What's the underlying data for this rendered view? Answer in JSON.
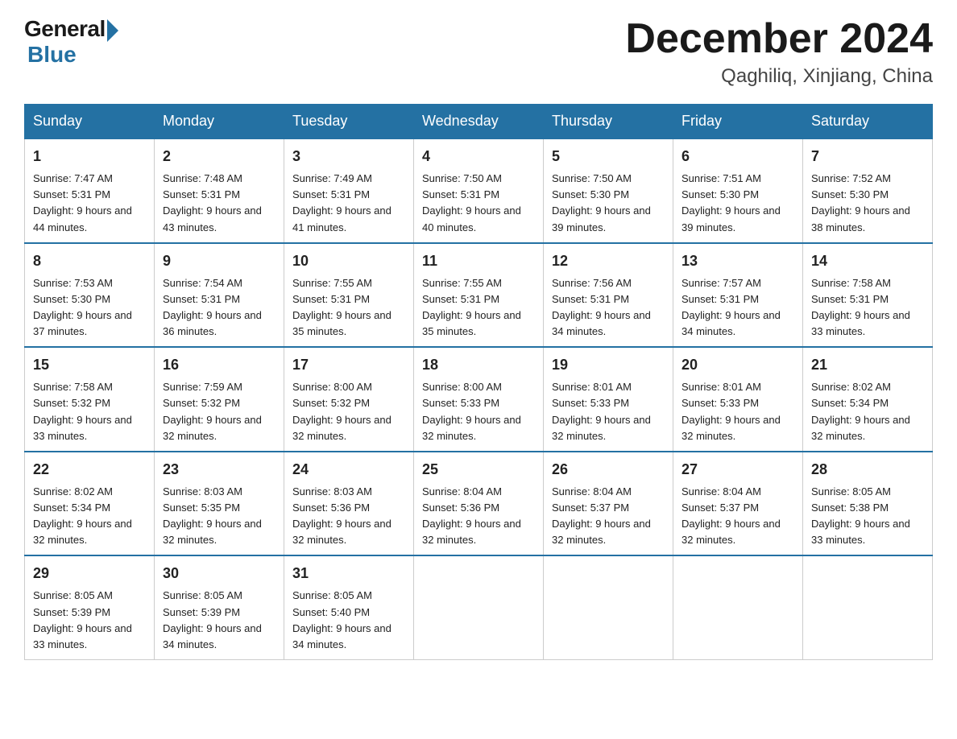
{
  "header": {
    "logo_general": "General",
    "logo_blue": "Blue",
    "month_title": "December 2024",
    "location": "Qaghiliq, Xinjiang, China"
  },
  "days_of_week": [
    "Sunday",
    "Monday",
    "Tuesday",
    "Wednesday",
    "Thursday",
    "Friday",
    "Saturday"
  ],
  "weeks": [
    [
      {
        "day": "1",
        "sunrise": "7:47 AM",
        "sunset": "5:31 PM",
        "daylight": "9 hours and 44 minutes."
      },
      {
        "day": "2",
        "sunrise": "7:48 AM",
        "sunset": "5:31 PM",
        "daylight": "9 hours and 43 minutes."
      },
      {
        "day": "3",
        "sunrise": "7:49 AM",
        "sunset": "5:31 PM",
        "daylight": "9 hours and 41 minutes."
      },
      {
        "day": "4",
        "sunrise": "7:50 AM",
        "sunset": "5:31 PM",
        "daylight": "9 hours and 40 minutes."
      },
      {
        "day": "5",
        "sunrise": "7:50 AM",
        "sunset": "5:30 PM",
        "daylight": "9 hours and 39 minutes."
      },
      {
        "day": "6",
        "sunrise": "7:51 AM",
        "sunset": "5:30 PM",
        "daylight": "9 hours and 39 minutes."
      },
      {
        "day": "7",
        "sunrise": "7:52 AM",
        "sunset": "5:30 PM",
        "daylight": "9 hours and 38 minutes."
      }
    ],
    [
      {
        "day": "8",
        "sunrise": "7:53 AM",
        "sunset": "5:30 PM",
        "daylight": "9 hours and 37 minutes."
      },
      {
        "day": "9",
        "sunrise": "7:54 AM",
        "sunset": "5:31 PM",
        "daylight": "9 hours and 36 minutes."
      },
      {
        "day": "10",
        "sunrise": "7:55 AM",
        "sunset": "5:31 PM",
        "daylight": "9 hours and 35 minutes."
      },
      {
        "day": "11",
        "sunrise": "7:55 AM",
        "sunset": "5:31 PM",
        "daylight": "9 hours and 35 minutes."
      },
      {
        "day": "12",
        "sunrise": "7:56 AM",
        "sunset": "5:31 PM",
        "daylight": "9 hours and 34 minutes."
      },
      {
        "day": "13",
        "sunrise": "7:57 AM",
        "sunset": "5:31 PM",
        "daylight": "9 hours and 34 minutes."
      },
      {
        "day": "14",
        "sunrise": "7:58 AM",
        "sunset": "5:31 PM",
        "daylight": "9 hours and 33 minutes."
      }
    ],
    [
      {
        "day": "15",
        "sunrise": "7:58 AM",
        "sunset": "5:32 PM",
        "daylight": "9 hours and 33 minutes."
      },
      {
        "day": "16",
        "sunrise": "7:59 AM",
        "sunset": "5:32 PM",
        "daylight": "9 hours and 32 minutes."
      },
      {
        "day": "17",
        "sunrise": "8:00 AM",
        "sunset": "5:32 PM",
        "daylight": "9 hours and 32 minutes."
      },
      {
        "day": "18",
        "sunrise": "8:00 AM",
        "sunset": "5:33 PM",
        "daylight": "9 hours and 32 minutes."
      },
      {
        "day": "19",
        "sunrise": "8:01 AM",
        "sunset": "5:33 PM",
        "daylight": "9 hours and 32 minutes."
      },
      {
        "day": "20",
        "sunrise": "8:01 AM",
        "sunset": "5:33 PM",
        "daylight": "9 hours and 32 minutes."
      },
      {
        "day": "21",
        "sunrise": "8:02 AM",
        "sunset": "5:34 PM",
        "daylight": "9 hours and 32 minutes."
      }
    ],
    [
      {
        "day": "22",
        "sunrise": "8:02 AM",
        "sunset": "5:34 PM",
        "daylight": "9 hours and 32 minutes."
      },
      {
        "day": "23",
        "sunrise": "8:03 AM",
        "sunset": "5:35 PM",
        "daylight": "9 hours and 32 minutes."
      },
      {
        "day": "24",
        "sunrise": "8:03 AM",
        "sunset": "5:36 PM",
        "daylight": "9 hours and 32 minutes."
      },
      {
        "day": "25",
        "sunrise": "8:04 AM",
        "sunset": "5:36 PM",
        "daylight": "9 hours and 32 minutes."
      },
      {
        "day": "26",
        "sunrise": "8:04 AM",
        "sunset": "5:37 PM",
        "daylight": "9 hours and 32 minutes."
      },
      {
        "day": "27",
        "sunrise": "8:04 AM",
        "sunset": "5:37 PM",
        "daylight": "9 hours and 32 minutes."
      },
      {
        "day": "28",
        "sunrise": "8:05 AM",
        "sunset": "5:38 PM",
        "daylight": "9 hours and 33 minutes."
      }
    ],
    [
      {
        "day": "29",
        "sunrise": "8:05 AM",
        "sunset": "5:39 PM",
        "daylight": "9 hours and 33 minutes."
      },
      {
        "day": "30",
        "sunrise": "8:05 AM",
        "sunset": "5:39 PM",
        "daylight": "9 hours and 34 minutes."
      },
      {
        "day": "31",
        "sunrise": "8:05 AM",
        "sunset": "5:40 PM",
        "daylight": "9 hours and 34 minutes."
      },
      null,
      null,
      null,
      null
    ]
  ]
}
